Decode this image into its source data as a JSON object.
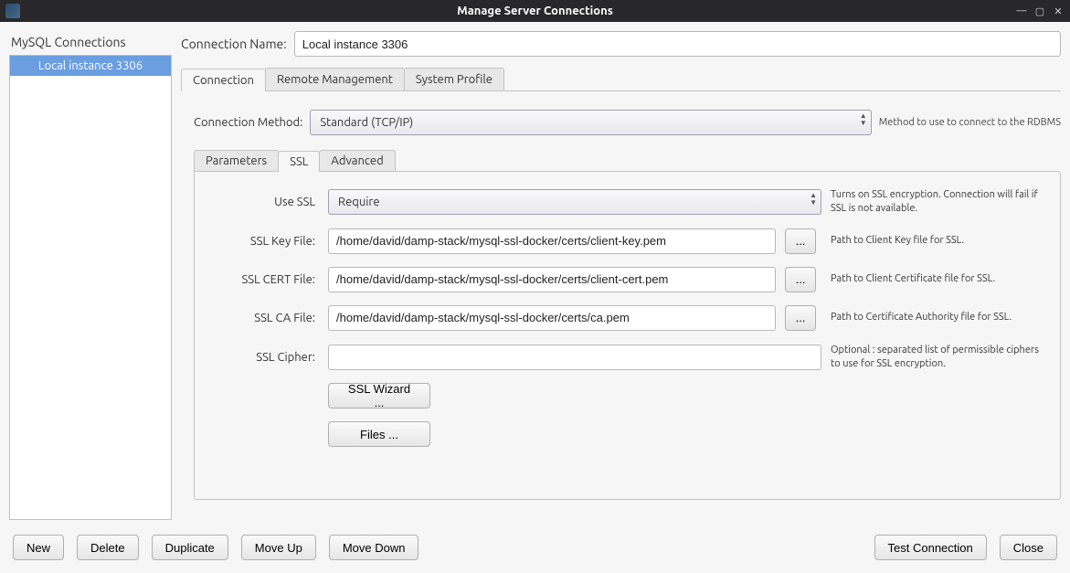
{
  "window": {
    "title": "Manage Server Connections"
  },
  "sidebar": {
    "header": "MySQL Connections",
    "items": [
      {
        "label": "Local instance 3306",
        "selected": true
      }
    ]
  },
  "connection_name": {
    "label": "Connection Name:",
    "value": "Local instance 3306"
  },
  "tabs": {
    "t0": "Connection",
    "t1": "Remote Management",
    "t2": "System Profile",
    "active": "Connection"
  },
  "method": {
    "label": "Connection Method:",
    "value": "Standard (TCP/IP)",
    "hint": "Method to use to connect to the RDBMS"
  },
  "subtabs": {
    "s0": "Parameters",
    "s1": "SSL",
    "s2": "Advanced",
    "active": "SSL"
  },
  "ssl": {
    "use_label": "Use SSL",
    "use_value": "Require",
    "use_help": "Turns on SSL encryption. Connection will fail if SSL is not available.",
    "key_label": "SSL Key File:",
    "key_value": "/home/david/damp-stack/mysql-ssl-docker/certs/client-key.pem",
    "key_help": "Path to Client Key file for SSL.",
    "cert_label": "SSL CERT File:",
    "cert_value": "/home/david/damp-stack/mysql-ssl-docker/certs/client-cert.pem",
    "cert_help": "Path to Client Certificate file for SSL.",
    "ca_label": "SSL CA File:",
    "ca_value": "/home/david/damp-stack/mysql-ssl-docker/certs/ca.pem",
    "ca_help": "Path to Certificate Authority file for SSL.",
    "cipher_label": "SSL Cipher:",
    "cipher_value": "",
    "cipher_help": "Optional : separated list of permissible ciphers to use for SSL encryption.",
    "browse": "...",
    "wizard_btn": "SSL Wizard ...",
    "files_btn": "Files ..."
  },
  "footer": {
    "new": "New",
    "delete": "Delete",
    "duplicate": "Duplicate",
    "moveup": "Move Up",
    "movedown": "Move Down",
    "test": "Test Connection",
    "close": "Close"
  }
}
